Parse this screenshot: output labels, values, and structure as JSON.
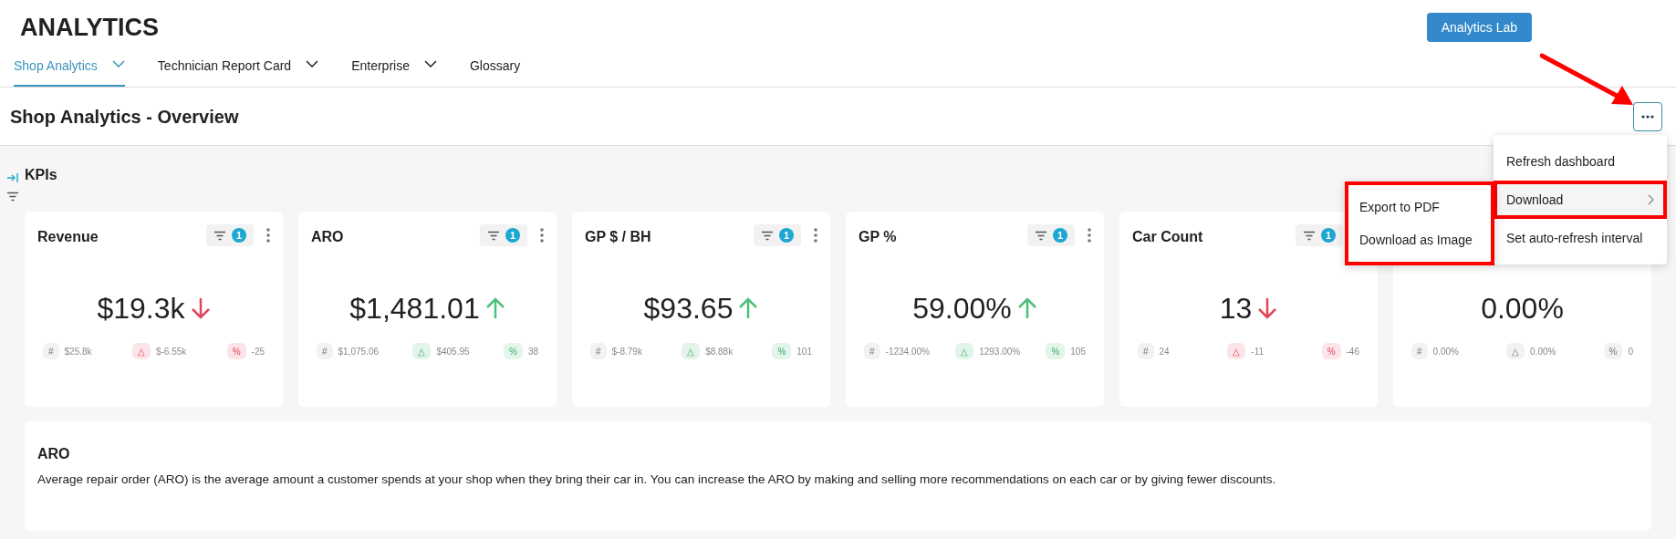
{
  "header": {
    "title": "ANALYTICS",
    "lab_button": "Analytics Lab"
  },
  "tabs": [
    {
      "label": "Shop Analytics",
      "selected": true,
      "dropdown": true
    },
    {
      "label": "Technician Report Card",
      "selected": false,
      "dropdown": true
    },
    {
      "label": "Enterprise",
      "selected": false,
      "dropdown": true
    },
    {
      "label": "Glossary",
      "selected": false,
      "dropdown": false
    }
  ],
  "page_title": "Shop Analytics - Overview",
  "section_title": "KPIs",
  "cards": [
    {
      "title": "Revenue",
      "filter_count": "1",
      "value": "$19.3k",
      "up": false,
      "more": true,
      "stats": [
        {
          "symbol": "#",
          "value": "$25.8k",
          "color": "#f2f2f2"
        },
        {
          "symbol": "△",
          "value": "$-6.55k",
          "color": "#fbe5e8"
        },
        {
          "symbol": "%",
          "value": "-25",
          "color": "#fbe5e8"
        }
      ]
    },
    {
      "title": "ARO",
      "filter_count": "1",
      "value": "$1,481.01",
      "up": true,
      "more": true,
      "stats": [
        {
          "symbol": "#",
          "value": "$1,075.06",
          "color": "#f2f2f2"
        },
        {
          "symbol": "△",
          "value": "$405.95",
          "color": "#e3f4ea"
        },
        {
          "symbol": "%",
          "value": "38",
          "color": "#e3f4ea"
        }
      ]
    },
    {
      "title": "GP $ / BH",
      "filter_count": "1",
      "value": "$93.65",
      "up": true,
      "more": true,
      "stats": [
        {
          "symbol": "#",
          "value": "$-8.79k",
          "color": "#f2f2f2"
        },
        {
          "symbol": "△",
          "value": "$8.88k",
          "color": "#e3f4ea"
        },
        {
          "symbol": "%",
          "value": "101",
          "color": "#e3f4ea"
        }
      ]
    },
    {
      "title": "GP %",
      "filter_count": "1",
      "value": "59.00%",
      "up": true,
      "more": true,
      "stats": [
        {
          "symbol": "#",
          "value": "-1234.00%",
          "color": "#f2f2f2"
        },
        {
          "symbol": "△",
          "value": "1293.00%",
          "color": "#e3f4ea"
        },
        {
          "symbol": "%",
          "value": "105",
          "color": "#e3f4ea"
        }
      ]
    },
    {
      "title": "Car Count",
      "filter_count": "1",
      "value": "13",
      "up": false,
      "more": false,
      "stats": [
        {
          "symbol": "#",
          "value": "24",
          "color": "#f2f2f2"
        },
        {
          "symbol": "△",
          "value": "-11",
          "color": "#fbe5e8"
        },
        {
          "symbol": "%",
          "value": "-46",
          "color": "#fbe5e8"
        }
      ]
    },
    {
      "value": "0.00%",
      "stats": [
        {
          "symbol": "#",
          "value": "0.00%",
          "color": "#f2f2f2"
        },
        {
          "symbol": "△",
          "value": "0.00%",
          "color": "#f2f2f2"
        },
        {
          "symbol": "%",
          "value": "0",
          "color": "#f2f2f2"
        }
      ]
    }
  ],
  "description": {
    "title": "ARO",
    "text": "Average repair order (ARO) is the average amount a customer spends at your shop when they bring their car in. You can increase the ARO by making and selling more recommendations on each car or by giving fewer discounts."
  },
  "menu": {
    "items": [
      {
        "label": "Refresh dashboard",
        "submenu": false,
        "highlighted": false
      },
      {
        "label": "Download",
        "submenu": true,
        "highlighted": true
      },
      {
        "label": "Set auto-refresh interval",
        "submenu": false,
        "highlighted": false
      }
    ],
    "submenu": {
      "highlighted": true,
      "items": [
        "Export to PDF",
        "Download as Image"
      ]
    }
  }
}
